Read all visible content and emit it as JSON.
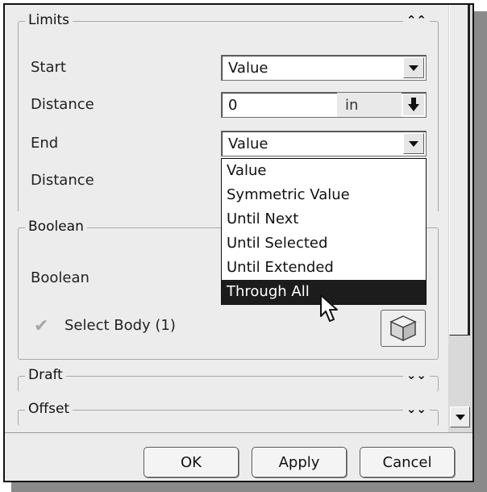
{
  "limits": {
    "title": "Limits",
    "start_label": "Start",
    "start_value": "Value",
    "distance_label": "Distance",
    "distance_value": "0",
    "distance_unit": "in",
    "end_label": "End",
    "end_value": "Value",
    "distance2_label": "Distance"
  },
  "end_dropdown": {
    "options": [
      "Value",
      "Symmetric Value",
      "Until Next",
      "Until Selected",
      "Until Extended",
      "Through All"
    ],
    "highlighted": "Through All"
  },
  "boolean": {
    "title": "Boolean",
    "label": "Boolean",
    "select_body": "Select Body (1)"
  },
  "draft": {
    "title": "Draft"
  },
  "offset": {
    "title": "Offset"
  },
  "buttons": {
    "ok": "OK",
    "apply": "Apply",
    "cancel": "Cancel"
  },
  "icons": {
    "collapse": "double-chevron-up-icon",
    "expand": "double-chevron-down-icon",
    "check": "check-icon",
    "body": "cube-icon",
    "cursor": "mouse-pointer-icon"
  }
}
